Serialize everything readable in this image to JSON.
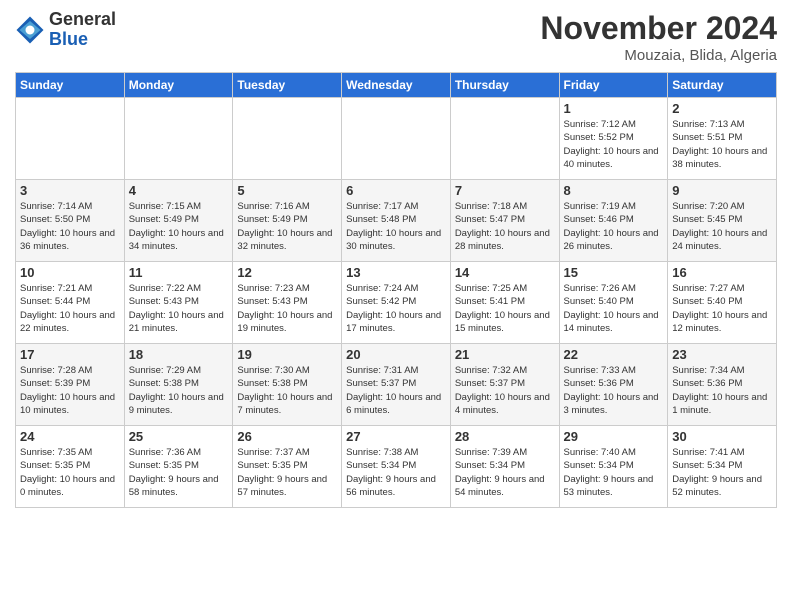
{
  "header": {
    "logo_general": "General",
    "logo_blue": "Blue",
    "month_title": "November 2024",
    "location": "Mouzaia, Blida, Algeria"
  },
  "weekdays": [
    "Sunday",
    "Monday",
    "Tuesday",
    "Wednesday",
    "Thursday",
    "Friday",
    "Saturday"
  ],
  "weeks": [
    {
      "row_class": "",
      "days": [
        {
          "num": "",
          "info": ""
        },
        {
          "num": "",
          "info": ""
        },
        {
          "num": "",
          "info": ""
        },
        {
          "num": "",
          "info": ""
        },
        {
          "num": "",
          "info": ""
        },
        {
          "num": "1",
          "info": "Sunrise: 7:12 AM\nSunset: 5:52 PM\nDaylight: 10 hours and 40 minutes."
        },
        {
          "num": "2",
          "info": "Sunrise: 7:13 AM\nSunset: 5:51 PM\nDaylight: 10 hours and 38 minutes."
        }
      ]
    },
    {
      "row_class": "alt-row",
      "days": [
        {
          "num": "3",
          "info": "Sunrise: 7:14 AM\nSunset: 5:50 PM\nDaylight: 10 hours and 36 minutes."
        },
        {
          "num": "4",
          "info": "Sunrise: 7:15 AM\nSunset: 5:49 PM\nDaylight: 10 hours and 34 minutes."
        },
        {
          "num": "5",
          "info": "Sunrise: 7:16 AM\nSunset: 5:49 PM\nDaylight: 10 hours and 32 minutes."
        },
        {
          "num": "6",
          "info": "Sunrise: 7:17 AM\nSunset: 5:48 PM\nDaylight: 10 hours and 30 minutes."
        },
        {
          "num": "7",
          "info": "Sunrise: 7:18 AM\nSunset: 5:47 PM\nDaylight: 10 hours and 28 minutes."
        },
        {
          "num": "8",
          "info": "Sunrise: 7:19 AM\nSunset: 5:46 PM\nDaylight: 10 hours and 26 minutes."
        },
        {
          "num": "9",
          "info": "Sunrise: 7:20 AM\nSunset: 5:45 PM\nDaylight: 10 hours and 24 minutes."
        }
      ]
    },
    {
      "row_class": "",
      "days": [
        {
          "num": "10",
          "info": "Sunrise: 7:21 AM\nSunset: 5:44 PM\nDaylight: 10 hours and 22 minutes."
        },
        {
          "num": "11",
          "info": "Sunrise: 7:22 AM\nSunset: 5:43 PM\nDaylight: 10 hours and 21 minutes."
        },
        {
          "num": "12",
          "info": "Sunrise: 7:23 AM\nSunset: 5:43 PM\nDaylight: 10 hours and 19 minutes."
        },
        {
          "num": "13",
          "info": "Sunrise: 7:24 AM\nSunset: 5:42 PM\nDaylight: 10 hours and 17 minutes."
        },
        {
          "num": "14",
          "info": "Sunrise: 7:25 AM\nSunset: 5:41 PM\nDaylight: 10 hours and 15 minutes."
        },
        {
          "num": "15",
          "info": "Sunrise: 7:26 AM\nSunset: 5:40 PM\nDaylight: 10 hours and 14 minutes."
        },
        {
          "num": "16",
          "info": "Sunrise: 7:27 AM\nSunset: 5:40 PM\nDaylight: 10 hours and 12 minutes."
        }
      ]
    },
    {
      "row_class": "alt-row",
      "days": [
        {
          "num": "17",
          "info": "Sunrise: 7:28 AM\nSunset: 5:39 PM\nDaylight: 10 hours and 10 minutes."
        },
        {
          "num": "18",
          "info": "Sunrise: 7:29 AM\nSunset: 5:38 PM\nDaylight: 10 hours and 9 minutes."
        },
        {
          "num": "19",
          "info": "Sunrise: 7:30 AM\nSunset: 5:38 PM\nDaylight: 10 hours and 7 minutes."
        },
        {
          "num": "20",
          "info": "Sunrise: 7:31 AM\nSunset: 5:37 PM\nDaylight: 10 hours and 6 minutes."
        },
        {
          "num": "21",
          "info": "Sunrise: 7:32 AM\nSunset: 5:37 PM\nDaylight: 10 hours and 4 minutes."
        },
        {
          "num": "22",
          "info": "Sunrise: 7:33 AM\nSunset: 5:36 PM\nDaylight: 10 hours and 3 minutes."
        },
        {
          "num": "23",
          "info": "Sunrise: 7:34 AM\nSunset: 5:36 PM\nDaylight: 10 hours and 1 minute."
        }
      ]
    },
    {
      "row_class": "",
      "days": [
        {
          "num": "24",
          "info": "Sunrise: 7:35 AM\nSunset: 5:35 PM\nDaylight: 10 hours and 0 minutes."
        },
        {
          "num": "25",
          "info": "Sunrise: 7:36 AM\nSunset: 5:35 PM\nDaylight: 9 hours and 58 minutes."
        },
        {
          "num": "26",
          "info": "Sunrise: 7:37 AM\nSunset: 5:35 PM\nDaylight: 9 hours and 57 minutes."
        },
        {
          "num": "27",
          "info": "Sunrise: 7:38 AM\nSunset: 5:34 PM\nDaylight: 9 hours and 56 minutes."
        },
        {
          "num": "28",
          "info": "Sunrise: 7:39 AM\nSunset: 5:34 PM\nDaylight: 9 hours and 54 minutes."
        },
        {
          "num": "29",
          "info": "Sunrise: 7:40 AM\nSunset: 5:34 PM\nDaylight: 9 hours and 53 minutes."
        },
        {
          "num": "30",
          "info": "Sunrise: 7:41 AM\nSunset: 5:34 PM\nDaylight: 9 hours and 52 minutes."
        }
      ]
    }
  ]
}
